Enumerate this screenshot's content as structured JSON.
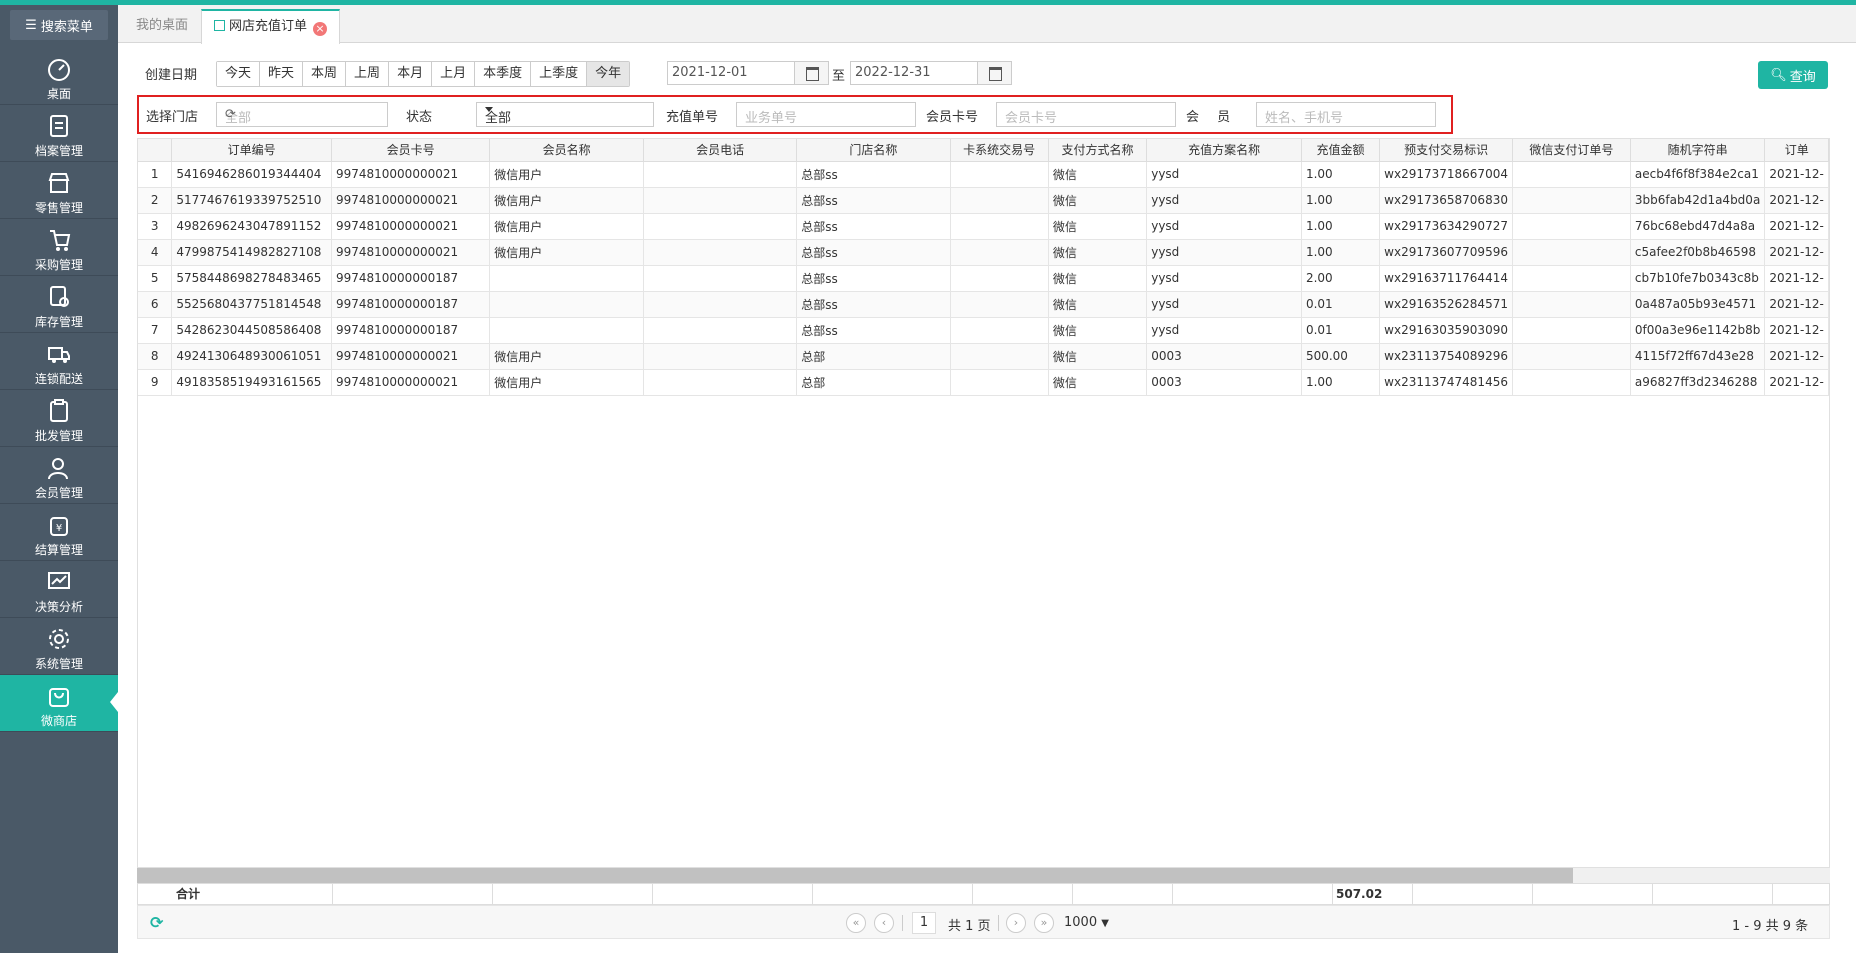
{
  "sidebar": {
    "search_label": "搜索菜单",
    "items": [
      {
        "label": "桌面",
        "icon": "dashboard-icon"
      },
      {
        "label": "档案管理",
        "icon": "archive-icon"
      },
      {
        "label": "零售管理",
        "icon": "store-icon"
      },
      {
        "label": "采购管理",
        "icon": "cart-icon"
      },
      {
        "label": "库存管理",
        "icon": "inventory-icon"
      },
      {
        "label": "连锁配送",
        "icon": "truck-icon"
      },
      {
        "label": "批发管理",
        "icon": "clipboard-icon"
      },
      {
        "label": "会员管理",
        "icon": "member-icon"
      },
      {
        "label": "结算管理",
        "icon": "settlement-icon"
      },
      {
        "label": "决策分析",
        "icon": "chart-icon"
      },
      {
        "label": "系统管理",
        "icon": "gear-icon"
      },
      {
        "label": "微商店",
        "icon": "bag-icon"
      }
    ],
    "active_index": 11
  },
  "tabs": {
    "home": "我的桌面",
    "current": "网店充值订单"
  },
  "filters": {
    "create_date_label": "创建日期",
    "date_buttons": [
      "今天",
      "昨天",
      "本周",
      "上周",
      "本月",
      "上月",
      "本季度",
      "上季度",
      "今年"
    ],
    "date_from": "2021-12-01",
    "to_label": "至",
    "date_to": "2022-12-31",
    "query_label": "查询",
    "store_label": "选择门店",
    "store_value": "全部",
    "status_label": "状态",
    "status_value": "全部",
    "recharge_no_label": "充值单号",
    "recharge_no_placeholder": "业务单号",
    "card_label": "会员卡号",
    "card_placeholder": "会员卡号",
    "member_label": "会 员",
    "member_placeholder": "姓名、手机号"
  },
  "table": {
    "columns": [
      "订单编号",
      "会员卡号",
      "会员名称",
      "会员电话",
      "门店名称",
      "卡系统交易号",
      "支付方式名称",
      "充值方案名称",
      "充值金额",
      "预支付交易标识",
      "微信支付订单号",
      "随机字符串",
      "订单"
    ],
    "rows": [
      [
        "1",
        "5416946286019344404",
        "9974810000000021",
        "微信用户",
        "",
        "总部ss",
        "",
        "微信",
        "yysd",
        "1.00",
        "wx29173718667004",
        "",
        "aecb4f6f8f384e2ca1",
        "2021-12-"
      ],
      [
        "2",
        "5177467619339752510",
        "9974810000000021",
        "微信用户",
        "",
        "总部ss",
        "",
        "微信",
        "yysd",
        "1.00",
        "wx29173658706830",
        "",
        "3bb6fab42d1a4bd0a",
        "2021-12-"
      ],
      [
        "3",
        "4982696243047891152",
        "9974810000000021",
        "微信用户",
        "",
        "总部ss",
        "",
        "微信",
        "yysd",
        "1.00",
        "wx29173634290727",
        "",
        "76bc68ebd47d4a8a",
        "2021-12-"
      ],
      [
        "4",
        "4799875414982827108",
        "9974810000000021",
        "微信用户",
        "",
        "总部ss",
        "",
        "微信",
        "yysd",
        "1.00",
        "wx29173607709596",
        "",
        "c5afee2f0b8b46598",
        "2021-12-"
      ],
      [
        "5",
        "5758448698278483465",
        "9974810000000187",
        "",
        "",
        "总部ss",
        "",
        "微信",
        "yysd",
        "2.00",
        "wx29163711764414",
        "",
        "cb7b10fe7b0343c8b",
        "2021-12-"
      ],
      [
        "6",
        "5525680437751814548",
        "9974810000000187",
        "",
        "",
        "总部ss",
        "",
        "微信",
        "yysd",
        "0.01",
        "wx29163526284571",
        "",
        "0a487a05b93e4571",
        "2021-12-"
      ],
      [
        "7",
        "5428623044508586408",
        "9974810000000187",
        "",
        "",
        "总部ss",
        "",
        "微信",
        "yysd",
        "0.01",
        "wx29163035903090",
        "",
        "0f00a3e96e1142b8b",
        "2021-12-"
      ],
      [
        "8",
        "4924130648930061051",
        "9974810000000021",
        "微信用户",
        "",
        "总部",
        "",
        "微信",
        "0003",
        "500.00",
        "wx23113754089296",
        "",
        "4115f72ff67d43e28",
        "2021-12-"
      ],
      [
        "9",
        "4918358519493161565",
        "9974810000000021",
        "微信用户",
        "",
        "总部",
        "",
        "微信",
        "0003",
        "1.00",
        "wx23113747481456",
        "",
        "a96827ff3d2346288",
        "2021-12-"
      ]
    ],
    "footer_label": "合计",
    "footer_total": "507.02"
  },
  "pager": {
    "page": "1",
    "total_pages_text": "共 1 页",
    "page_size": "1000",
    "summary": "1 - 9 共 9 条"
  }
}
